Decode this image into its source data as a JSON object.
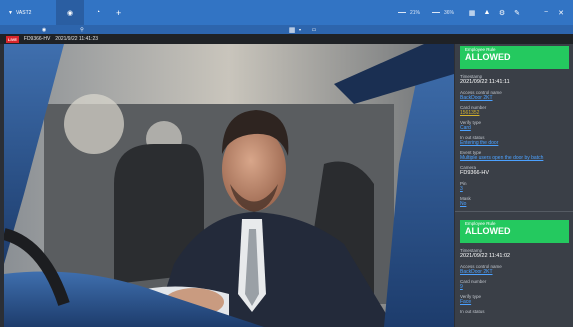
{
  "app": {
    "title": "VAST2"
  },
  "toolbar": {
    "meter1_label": "21%",
    "meter2_label": "36%"
  },
  "channel": {
    "live_badge": "LIVE",
    "camera_name": "FD9366-HV",
    "timestamp": "2021/9/22 11:41:23"
  },
  "events": [
    {
      "status_title": "Employee Rule",
      "status_value": "ALLOWED",
      "status_color": "#24c95f",
      "timestamp_label": "Timestamp",
      "timestamp": "2021/09/22 11:41:11",
      "access_label": "Access control name",
      "access_value": "BackDoor 2KT",
      "card_label": "Card number",
      "card_value": "1561352",
      "verify_label": "Verify type",
      "verify_value": "Card",
      "inout_label": "In out status",
      "inout_value": "Entering the door",
      "eventtype_label": "Event type",
      "eventtype_value": "Multiple users open the door by batch",
      "camera_label": "Camera",
      "camera_value": "FD9366-HV",
      "pin_label": "Pin",
      "pin_value": "3",
      "mask_label": "Mask",
      "mask_value": "No"
    },
    {
      "status_title": "Employee Rule",
      "status_value": "ALLOWED",
      "status_color": "#24c95f",
      "timestamp_label": "Timestamp",
      "timestamp": "2021/09/22 11:41:02",
      "access_label": "Access control name",
      "access_value": "BackDoor 2KT",
      "card_label": "Card number",
      "card_value": "9",
      "verify_label": "Verify type",
      "verify_value": "Face",
      "inout_label": "In out status"
    }
  ],
  "colors": {
    "topbar": "#3274c4",
    "allowed": "#24c95f",
    "live": "#d8262c",
    "link": "#4ba1ff"
  }
}
